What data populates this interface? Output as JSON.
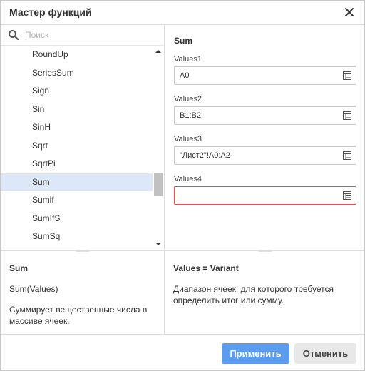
{
  "dialog": {
    "title": "Мастер функций"
  },
  "search": {
    "placeholder": "Поиск",
    "value": ""
  },
  "functions": {
    "items": [
      "RoundUp",
      "SeriesSum",
      "Sign",
      "Sin",
      "SinH",
      "Sqrt",
      "SqrtPi",
      "Sum",
      "Sumif",
      "SumIfS",
      "SumSq"
    ],
    "selected": "Sum"
  },
  "function_editor": {
    "name": "Sum",
    "args": [
      {
        "label": "Values1",
        "value": "A0",
        "valid": true
      },
      {
        "label": "Values2",
        "value": "B1:B2",
        "valid": true
      },
      {
        "label": "Values3",
        "value": "\"Лист2\"!A0:A2",
        "valid": true
      },
      {
        "label": "Values4",
        "value": "",
        "valid": false
      }
    ]
  },
  "function_info": {
    "name": "Sum",
    "syntax": "Sum(Values)",
    "description": "Суммирует вещественные числа в массиве ячеек."
  },
  "argument_info": {
    "title": "Values = Variant",
    "description": "Диапазон ячеек, для которого требуется определить итог или сумму."
  },
  "footer": {
    "apply_label": "Применить",
    "cancel_label": "Отменить"
  },
  "colors": {
    "accent": "#5b9cf0",
    "selected_row": "#dce8f7",
    "error_border": "#d9534f"
  }
}
